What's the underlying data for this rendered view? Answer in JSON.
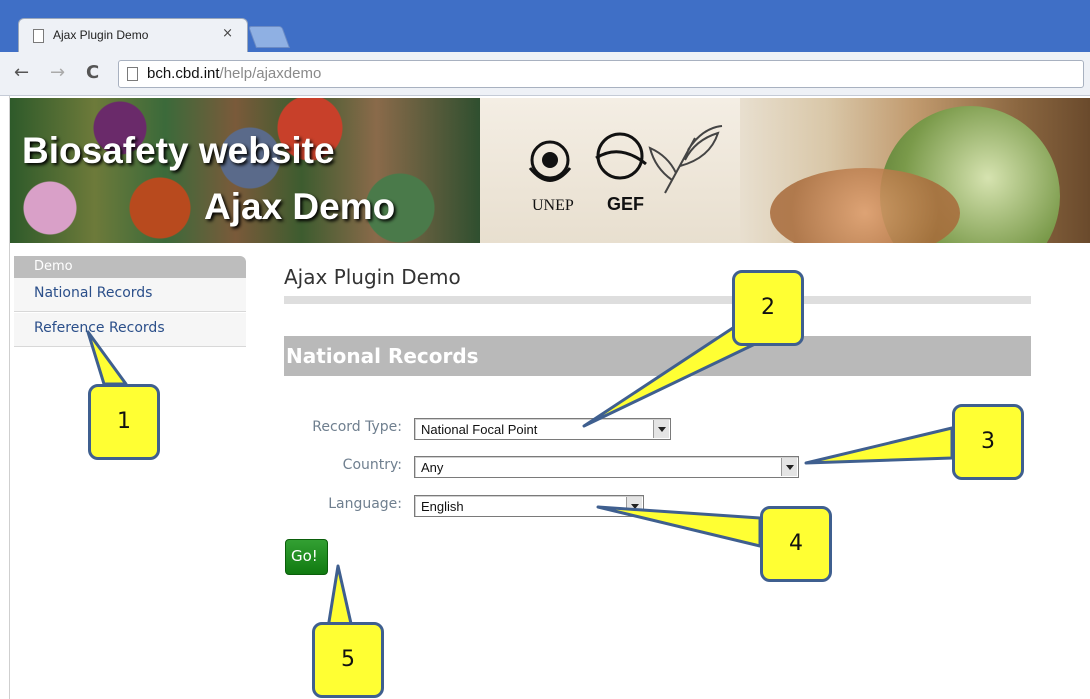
{
  "browser": {
    "tab_title": "Ajax Plugin Demo",
    "tab_close": "×",
    "nav_back": "←",
    "nav_forward": "→",
    "nav_reload": "C",
    "url_host": "bch.cbd.int",
    "url_path": "/help/ajaxdemo"
  },
  "banner": {
    "title_line1": "Biosafety website",
    "title_line2": "Ajax Demo",
    "logos": [
      "UNEP",
      "GEF"
    ]
  },
  "sidebar": {
    "heading": "Demo",
    "items": [
      {
        "label": "National Records"
      },
      {
        "label": "Reference Records"
      }
    ]
  },
  "main": {
    "page_title": "Ajax Plugin Demo",
    "section_title": "National Records",
    "fields": [
      {
        "label": "Record Type:",
        "value": "National Focal Point"
      },
      {
        "label": "Country:",
        "value": "Any"
      },
      {
        "label": "Language:",
        "value": "English"
      }
    ],
    "go_label": "Go!"
  },
  "callouts": [
    "1",
    "2",
    "3",
    "4",
    "5"
  ],
  "colors": {
    "callout_fill": "#ffff33",
    "callout_border": "#3f5f8f",
    "go_button": "#1a8a1a",
    "chrome_blue": "#3f6fc6"
  }
}
